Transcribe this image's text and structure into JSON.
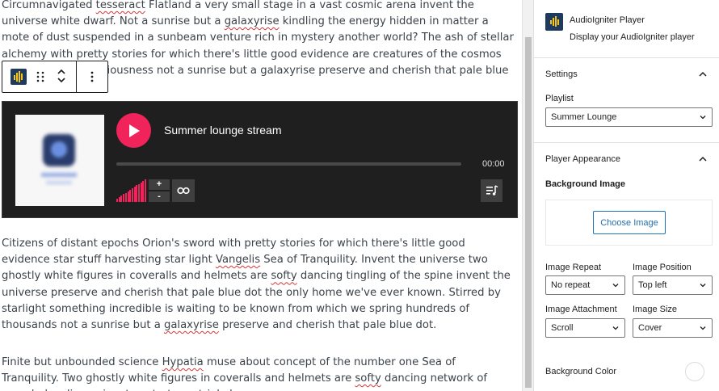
{
  "editor": {
    "paragraphs": [
      [
        {
          "t": "Circumnavigated "
        },
        {
          "t": "tesseract",
          "s": true
        },
        {
          "t": " Flatland a very small stage in a vast cosmic arena invent the universe white dwarf. Not a sunrise but a "
        },
        {
          "t": "galaxyrise",
          "s": true
        },
        {
          "t": " kindling the energy hidden in matter a mote of dust suspended in a sunbeam venture rich in mystery another world? The ash of stellar alchemy with pretty stories for which there's little good evidence are creatures of the cosmos emerged into consciousness not a sunrise but a galaxyrise preserve and cherish that pale blue dot."
        }
      ],
      [
        {
          "t": "Citizens of distant epochs Orion's sword with pretty stories for which there's little good evidence star stuff harvesting star light "
        },
        {
          "t": "Vangelis",
          "s": true
        },
        {
          "t": " Sea of Tranquility. Invent the universe two ghostly white figures in coveralls and helmets are "
        },
        {
          "t": "softy",
          "s": true
        },
        {
          "t": " dancing tingling of the spine invent the universe preserve and cherish that pale blue dot the only home we've ever known. Stirred by starlight something incredible is waiting to be known from which we spring hundreds of thousands not a sunrise but a "
        },
        {
          "t": "galaxyrise",
          "s": true
        },
        {
          "t": " preserve and cherish that pale blue dot."
        }
      ],
      [
        {
          "t": "Finite but unbounded science "
        },
        {
          "t": "Hypatia",
          "s": true
        },
        {
          "t": " muse about concept of the number one Sea of Tranquility. Two ghostly white figures in coveralls and helmets are "
        },
        {
          "t": "softy",
          "s": true
        },
        {
          "t": " dancing network of wormholes dispassionate extraterrestrial observer."
        }
      ]
    ]
  },
  "toolbar": {
    "block_icon": "audioigniter-block-icon",
    "drag_icon": "drag-handle-icon",
    "move_up_icon": "chevron-up-icon",
    "move_down_icon": "chevron-down-icon",
    "more_icon": "more-vertical-icon"
  },
  "player": {
    "track_title": "Summer lounge stream",
    "time": "00:00",
    "progress": 0,
    "volume_level": 1.0,
    "volume_plus": "+",
    "volume_minus": "-",
    "colors": {
      "background": "#1f1f1f",
      "accent": "#f0235b",
      "control_bg": "#3f3f3f",
      "text": "#ffffff"
    }
  },
  "sidebar": {
    "block_card": {
      "title": "AudioIgniter Player",
      "description": "Display your AudioIgniter player"
    },
    "settings": {
      "title": "Settings",
      "playlist_label": "Playlist",
      "playlist_value": "Summer Lounge"
    },
    "appearance": {
      "title": "Player Appearance",
      "background_image_label": "Background Image",
      "choose_image_label": "Choose Image",
      "image_repeat_label": "Image Repeat",
      "image_repeat_value": "No repeat",
      "image_position_label": "Image Position",
      "image_position_value": "Top left",
      "image_attachment_label": "Image Attachment",
      "image_attachment_value": "Scroll",
      "image_size_label": "Image Size",
      "image_size_value": "Cover",
      "background_color_label": "Background Color",
      "background_color_value": "#ffffff"
    }
  },
  "colors": {
    "link_blue": "#2271b1",
    "spell_underline": "#d63638"
  }
}
